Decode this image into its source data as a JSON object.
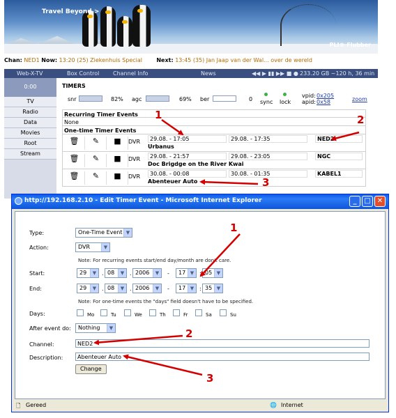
{
  "banner": {
    "tagline": "Travel Beyond >",
    "brand": "PLI® Flubber"
  },
  "ticker": {
    "chan_label": "Chan:",
    "chan_value": "NED1",
    "now_label": "Now:",
    "now_value": "13:20 (25) Ziekenhuis Special",
    "next_label": "Next:",
    "next_value": "13:45 (35) Jan Jaap van der Wal... over de wereld"
  },
  "navbar": {
    "webx": "Web-X-TV",
    "box_control": "Box Control",
    "channel_info": "Channel Info",
    "news": "News",
    "player_icons": "◀◀ ▶ ▮▮ ▶▶ ■ ●",
    "disk": "233.20 GB ~120 h, 36 min"
  },
  "clock": "0:00",
  "leftnav": [
    "TV",
    "Radio",
    "Data",
    "Movies",
    "Root",
    "Stream"
  ],
  "timers": {
    "title": "TIMERS",
    "snr_label": "snr",
    "snr_value": "82%",
    "agc_label": "agc",
    "agc_value": "69%",
    "ber_label": "ber",
    "ber_value": "0",
    "sync": "sync",
    "lock": "lock",
    "vpid_label": "vpid:",
    "vpid_value": "0x205",
    "apid_label": "apid:",
    "apid_value": "0x58",
    "zoom": "zoom",
    "recurring_header": "Recurring Timer Events",
    "recurring_none": "None",
    "onetime_header": "One-time Timer Events",
    "rows": [
      {
        "type": "DVR",
        "start": "29.08. - 17:05",
        "end": "29.08. - 17:35",
        "channel": "NED2",
        "name": "Urbanus"
      },
      {
        "type": "DVR",
        "start": "29.08. - 21:57",
        "end": "29.08. - 23:05",
        "channel": "NGC",
        "name": "Doc Brigdge on the River Kwai"
      },
      {
        "type": "DVR",
        "start": "30.08. - 00:08",
        "end": "30.08. - 01:35",
        "channel": "KABEL1",
        "name": "Abenteuer Auto"
      }
    ]
  },
  "ie": {
    "title": "http://192.168.2.10 - Edit Timer Event - Microsoft Internet Explorer",
    "type_label": "Type:",
    "type_value": "One-Time Event",
    "action_label": "Action:",
    "action_value": "DVR",
    "note1": "Note: For recurring events start/end day/month are don't care.",
    "start_label": "Start:",
    "start": {
      "day": "29",
      "month": "08",
      "year": "2006",
      "hour": "17",
      "min": "05"
    },
    "end_label": "End:",
    "end": {
      "day": "29",
      "month": "08",
      "year": "2006",
      "hour": "17",
      "min": "35"
    },
    "note2": "Note: For one-time events the \"days\" field doesn't have to be specified.",
    "days_label": "Days:",
    "days": [
      "Mo",
      "Tu",
      "We",
      "Th",
      "Fr",
      "Sa",
      "Su"
    ],
    "after_label": "After event do:",
    "after_value": "Nothing",
    "channel_label": "Channel:",
    "channel_value": "NED2",
    "desc_label": "Description:",
    "desc_value": "Abenteuer Auto",
    "change_button": "Change",
    "status_left": "Gereed",
    "status_right": "Internet"
  },
  "annotations": [
    "1",
    "2",
    "3",
    "1",
    "2",
    "3"
  ],
  "annotation_color": "#d40000"
}
